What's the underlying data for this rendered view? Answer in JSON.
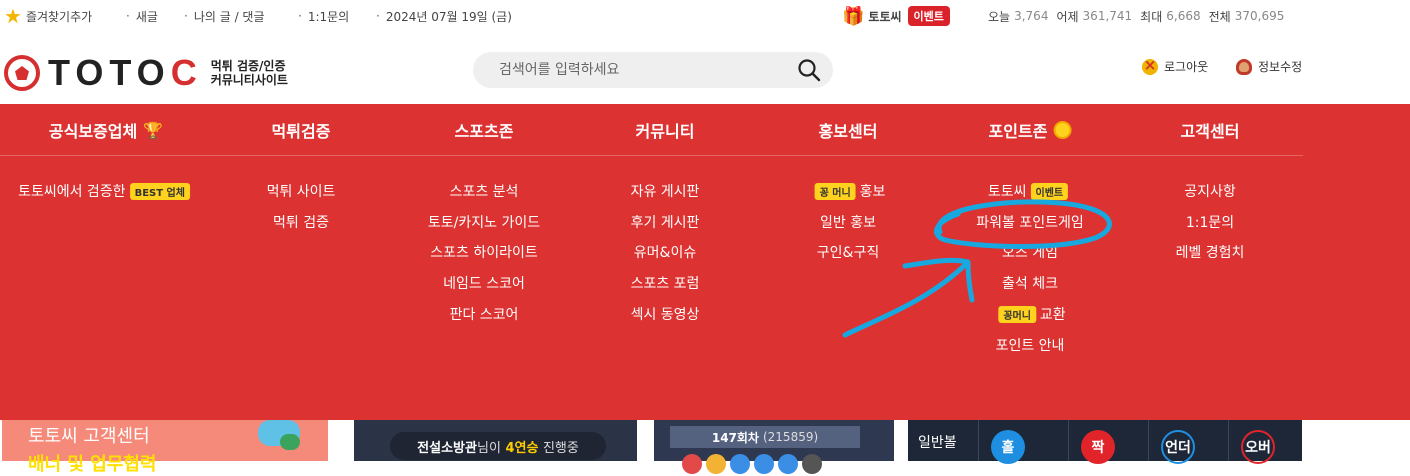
{
  "topbar": {
    "bookmark": "즐겨찾기추가",
    "new": "새글",
    "my_posts": "나의 글 / 댓글",
    "inquiry": "1:1문의",
    "date": "2024년 07월 19일 (금)",
    "event_name": "토토씨",
    "event_badge": "이벤트",
    "stats": {
      "today_label": "오늘",
      "today": "3,764",
      "yesterday_label": "어제",
      "yesterday": "361,741",
      "max_label": "최대",
      "max": "6,668",
      "total_label": "전체",
      "total": "370,695"
    }
  },
  "header": {
    "logo_text_main": "TOTO",
    "logo_text_c": "C",
    "logo_sub1": "먹튀 검증/인증",
    "logo_sub2": "커뮤니티사이트",
    "search_placeholder": "검색어를 입력하세요",
    "logout": "로그아웃",
    "edit_profile": "정보수정"
  },
  "menu": {
    "heads": [
      "공식보증업체",
      "먹튀검증",
      "스포츠존",
      "커뮤니티",
      "홍보센터",
      "포인트존",
      "고객센터"
    ],
    "col1": {
      "item1_pre": "토토씨에서 검증한",
      "item1_badge": "BEST 업체"
    },
    "col2": [
      "먹튀 사이트",
      "먹튀 검증"
    ],
    "col3": [
      "스포츠 분석",
      "토토/카지노 가이드",
      "스포츠 하이라이트",
      "네임드 스코어",
      "판다 스코어"
    ],
    "col4": [
      "자유 게시판",
      "후기 게시판",
      "유머&이슈",
      "스포츠 포럼",
      "섹시 동영상"
    ],
    "col5": {
      "promo_badge": "꽁 머니",
      "promo": "홍보",
      "general": "일반 홍보",
      "jobs": "구인&구직"
    },
    "col6": {
      "event_name": "토토씨",
      "event_badge": "이벤트",
      "powerball": "파워볼 포인트게임",
      "odds": "오즈 게임",
      "attendance": "출석 체크",
      "exchange_badge": "꽁머니",
      "exchange": "교환",
      "guide": "포인트 안내"
    },
    "col7": [
      "공지사항",
      "1:1문의",
      "레벨 경험치"
    ]
  },
  "bottom": {
    "cs_title": "토토씨 고객센터",
    "cs_sub": "배너 및 업무협력",
    "live_name": "전설소방관",
    "live_mid": "님이",
    "live_streak": "4연승",
    "live_end": "진행중",
    "round": "147회차",
    "round_sub": "(215859)",
    "pb_label": "일반볼",
    "pb_results": [
      "홀",
      "짝",
      "언더",
      "오버"
    ]
  },
  "colors": {
    "brand_red": "#dc3232",
    "badge_yellow": "#ffd21e",
    "annotation_blue": "#18a8e0"
  }
}
